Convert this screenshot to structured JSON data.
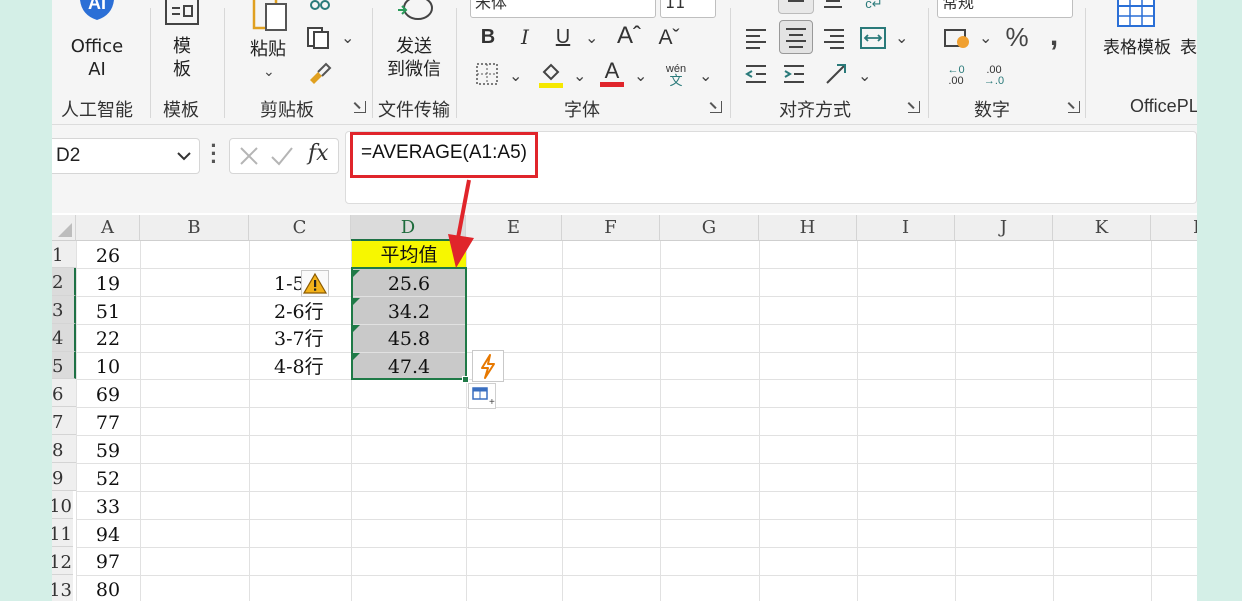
{
  "ribbon": {
    "groups": [
      {
        "label": "人工智能"
      },
      {
        "label": "模板"
      },
      {
        "label": "剪贴板"
      },
      {
        "label": "文件传输"
      },
      {
        "label": "字体"
      },
      {
        "label": "对齐方式"
      },
      {
        "label": "数字"
      },
      {
        "label": "OfficePL"
      }
    ],
    "office_ai": {
      "line1": "Office",
      "line2": "AI",
      "icon_text": "AI"
    },
    "template": {
      "line1": "模",
      "line2": "板"
    },
    "paste": {
      "label": "粘贴"
    },
    "send": {
      "line1": "发送",
      "line2": "到微信"
    },
    "font_name": "宋体",
    "font_size": "11",
    "number_format": "常规",
    "wen_label": "wén",
    "wen_char": "文",
    "table_template": "表格模板",
    "table_more": "表"
  },
  "formula_bar": {
    "name_box": "D2",
    "fx": "fx",
    "formula": "=AVERAGE(A1:A5)"
  },
  "columns": [
    "A",
    "B",
    "C",
    "D",
    "E",
    "F",
    "G",
    "H",
    "I",
    "J",
    "K",
    "L"
  ],
  "rows": [
    "1",
    "2",
    "3",
    "4",
    "5",
    "6",
    "7",
    "8",
    "9",
    "10",
    "11",
    "12",
    "13"
  ],
  "col_a": [
    "26",
    "19",
    "51",
    "22",
    "10",
    "69",
    "77",
    "59",
    "52",
    "33",
    "94",
    "97",
    "80"
  ],
  "col_c": [
    "1-5",
    "2-6行",
    "3-7行",
    "4-8行"
  ],
  "col_d_header": "平均值",
  "col_d": [
    "25.6",
    "34.2",
    "45.8",
    "47.4"
  ],
  "colors": {
    "accent_green": "#1f7a47",
    "header_yellow": "#f7f700",
    "annotation_red": "#e0252b",
    "selection_gray": "#c9c9c9"
  }
}
